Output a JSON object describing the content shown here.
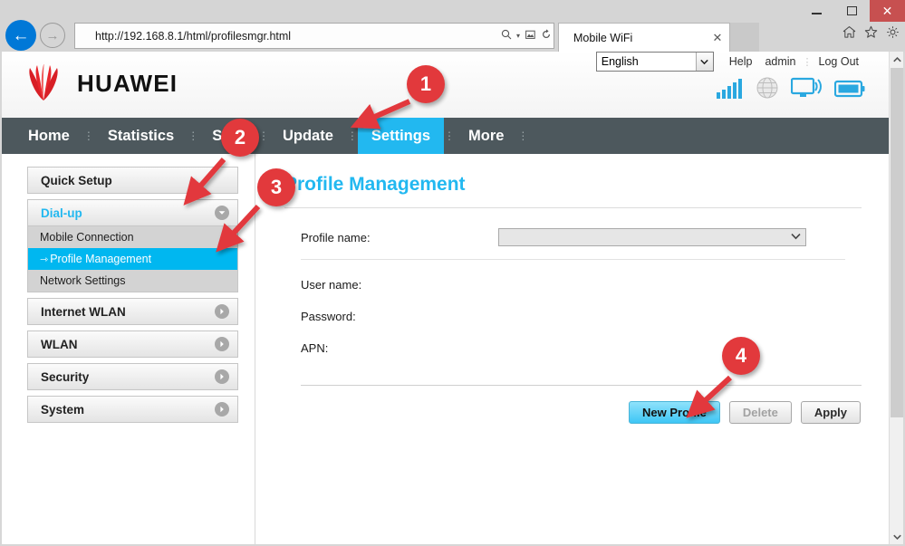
{
  "window": {
    "minimize_label": "—",
    "maximize_label": "□",
    "close_label": "✕"
  },
  "browser": {
    "back_label": "←",
    "forward_label": "→",
    "address": "http://192.168.8.1/html/profilesmgr.html",
    "search_icon": "search-icon",
    "compat_icon": "compatibility-view-icon",
    "refresh_icon": "refresh-icon",
    "caret": "▾",
    "tab_title": "Mobile WiFi",
    "tab_close": "✕",
    "home_icon": "home-icon",
    "favorites_icon": "star-icon",
    "settings_icon": "gear-icon"
  },
  "header": {
    "brand": "HUAWEI",
    "language": {
      "value": "English",
      "arrow": "⌄"
    },
    "links": [
      {
        "label": "Help"
      },
      {
        "label": "admin"
      },
      {
        "label": "Log Out"
      }
    ],
    "status_icons": [
      {
        "name": "signal-bars-icon"
      },
      {
        "name": "globe-icon"
      },
      {
        "name": "monitor-wifi-icon"
      },
      {
        "name": "battery-icon"
      }
    ]
  },
  "nav": {
    "items": [
      {
        "label": "Home",
        "active": false
      },
      {
        "label": "Statistics",
        "active": false
      },
      {
        "label": "SMS",
        "active": false
      },
      {
        "label": "Update",
        "active": false
      },
      {
        "label": "Settings",
        "active": true
      },
      {
        "label": "More",
        "active": false
      }
    ],
    "separator": "⋮",
    "active_color": "#22b8f0",
    "bar_color": "#4d585d"
  },
  "sidebar": {
    "groups": [
      {
        "label": "Quick Setup",
        "state": "plain",
        "arrow": null,
        "children": []
      },
      {
        "label": "Dial-up",
        "state": "open",
        "arrow": "▼",
        "children": [
          {
            "label": "Mobile Connection",
            "selected": false,
            "prefix": ""
          },
          {
            "label": "Profile Management",
            "selected": true,
            "prefix": "⇾"
          },
          {
            "label": "Network Settings",
            "selected": false,
            "prefix": ""
          }
        ]
      },
      {
        "label": "Internet WLAN",
        "state": "closed",
        "arrow": "▶",
        "children": []
      },
      {
        "label": "WLAN",
        "state": "closed",
        "arrow": "▶",
        "children": []
      },
      {
        "label": "Security",
        "state": "closed",
        "arrow": "▶",
        "children": []
      },
      {
        "label": "System",
        "state": "closed",
        "arrow": "▶",
        "children": []
      }
    ],
    "selected_color": "#00b7f0"
  },
  "content": {
    "title": "Profile Management",
    "fields": {
      "profile_name_label": "Profile name:",
      "profile_name_value": "",
      "profile_name_arrow": "⌄",
      "user_name_label": "User name:",
      "user_name_value": "",
      "password_label": "Password:",
      "password_value": "",
      "apn_label": "APN:",
      "apn_value": ""
    },
    "buttons": [
      {
        "label": "New Profile",
        "style": "primary"
      },
      {
        "label": "Delete",
        "style": "disabled"
      },
      {
        "label": "Apply",
        "style": "normal"
      }
    ]
  },
  "scrollbar": {
    "up": "⌃",
    "down": "⌄"
  },
  "annotations": {
    "accent_color": "#e2393c",
    "markers": [
      {
        "number": "1",
        "target": "settings-nav-item"
      },
      {
        "number": "2",
        "target": "dial-up-menu"
      },
      {
        "number": "3",
        "target": "profile-management-menu"
      },
      {
        "number": "4",
        "target": "new-profile-button"
      }
    ]
  }
}
